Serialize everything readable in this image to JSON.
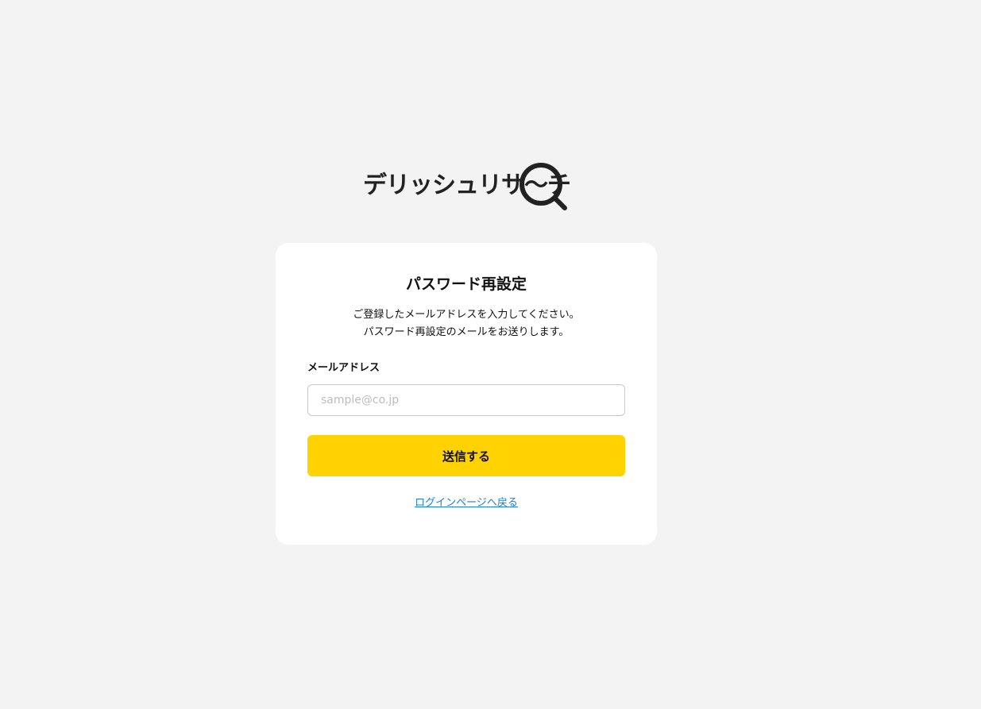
{
  "logo": {
    "text": "デリッシュリサ〜チ",
    "icon": "magnifier-icon"
  },
  "card": {
    "title": "パスワード再設定",
    "description_line1": "ご登録したメールアドレスを入力してください。",
    "description_line2": "パスワード再設定のメールをお送りします。",
    "email_label": "メールアドレス",
    "email_placeholder": "sample@co.jp",
    "email_value": "",
    "submit_label": "送信する",
    "back_link_label": "ログインページへ戻る"
  },
  "colors": {
    "background": "#f3f3f3",
    "card": "#ffffff",
    "accent": "#ffd200",
    "link": "#1a7fd4",
    "logo": "#222222"
  }
}
